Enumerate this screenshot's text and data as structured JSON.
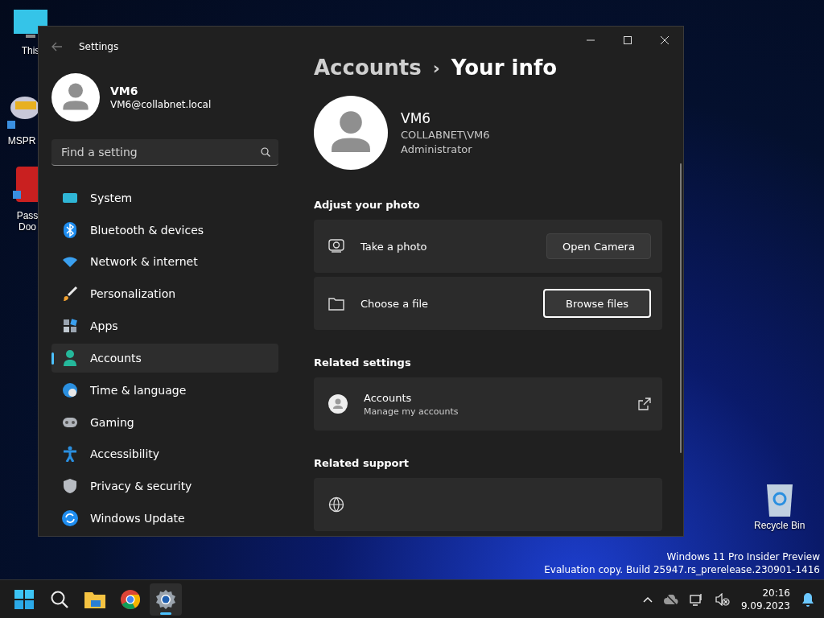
{
  "desktop_icons": [
    {
      "label": "This"
    },
    {
      "label": "MSPR"
    },
    {
      "label": "Pass\nDoo"
    },
    {
      "label": "Recycle Bin"
    }
  ],
  "window": {
    "title": "Settings"
  },
  "user": {
    "name": "VM6",
    "email": "VM6@collabnet.local"
  },
  "search": {
    "placeholder": "Find a setting"
  },
  "sidebar": {
    "items": [
      {
        "label": "System",
        "selected": false
      },
      {
        "label": "Bluetooth & devices",
        "selected": false
      },
      {
        "label": "Network & internet",
        "selected": false
      },
      {
        "label": "Personalization",
        "selected": false
      },
      {
        "label": "Apps",
        "selected": false
      },
      {
        "label": "Accounts",
        "selected": true
      },
      {
        "label": "Time & language",
        "selected": false
      },
      {
        "label": "Gaming",
        "selected": false
      },
      {
        "label": "Accessibility",
        "selected": false
      },
      {
        "label": "Privacy & security",
        "selected": false
      },
      {
        "label": "Windows Update",
        "selected": false
      }
    ]
  },
  "breadcrumb": {
    "parent": "Accounts",
    "separator": "›",
    "current": "Your info"
  },
  "profile": {
    "name": "VM6",
    "account": "COLLABNET\\VM6",
    "role": "Administrator"
  },
  "sections": [
    {
      "heading": "Adjust your photo",
      "rows": [
        {
          "kind": "camera",
          "label": "Take a photo",
          "button": "Open Camera",
          "focused": false
        },
        {
          "kind": "file",
          "label": "Choose a file",
          "button": "Browse files",
          "focused": true
        }
      ]
    },
    {
      "heading": "Related settings",
      "rows": [
        {
          "kind": "link",
          "label": "Accounts",
          "sublabel": "Manage my accounts"
        }
      ]
    },
    {
      "heading": "Related support",
      "rows": [
        {
          "kind": "help"
        }
      ]
    }
  ],
  "watermark": {
    "line1": "Windows 11 Pro Insider Preview",
    "line2": "Evaluation copy. Build 25947.rs_prerelease.230901-1416"
  },
  "taskbar": {
    "apps": [
      {
        "selected": false
      },
      {
        "selected": false
      },
      {
        "selected": false
      },
      {
        "selected": false
      },
      {
        "selected": true
      }
    ],
    "time": "20:16",
    "date": "9.09.2023"
  }
}
